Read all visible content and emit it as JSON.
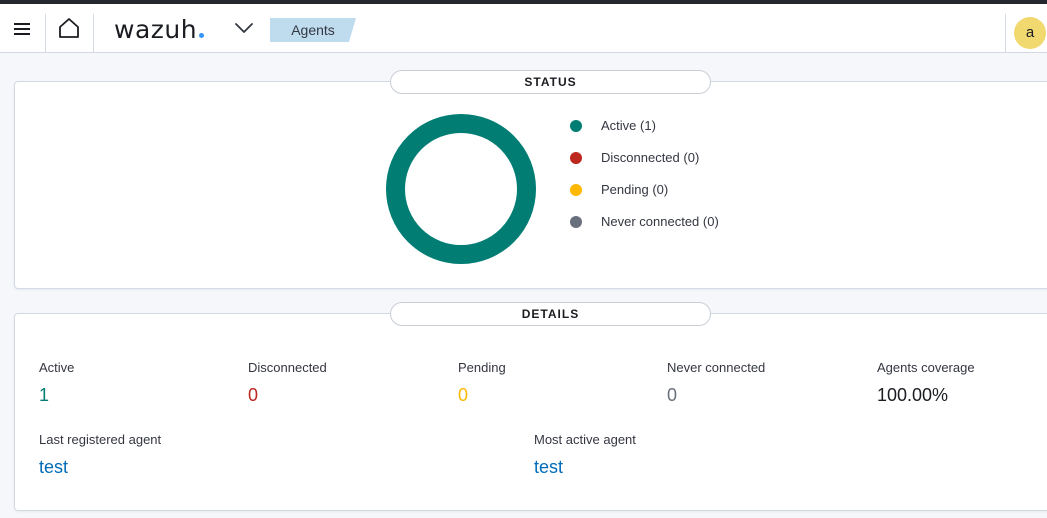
{
  "header": {
    "logo_text": "wazuh",
    "breadcrumb": "Agents",
    "avatar_letter": "a",
    "icons": [
      "menu-icon",
      "home-icon",
      "chevron-down-icon"
    ]
  },
  "status": {
    "title": "STATUS",
    "donut_color": "#017d73",
    "legend": [
      {
        "label": "Active (1)",
        "color": "#017d73"
      },
      {
        "label": "Disconnected (0)",
        "color": "#bd271e"
      },
      {
        "label": "Pending (0)",
        "color": "#feb800"
      },
      {
        "label": "Never connected (0)",
        "color": "#69707d"
      }
    ]
  },
  "details": {
    "title": "DETAILS",
    "stats": [
      {
        "label": "Active",
        "value": "1",
        "color": "#017d73"
      },
      {
        "label": "Disconnected",
        "value": "0",
        "color": "#bd271e"
      },
      {
        "label": "Pending",
        "value": "0",
        "color": "#feb800"
      },
      {
        "label": "Never connected",
        "value": "0",
        "color": "#69707d"
      },
      {
        "label": "Agents coverage",
        "value": "100.00%",
        "color": "#1a1c21"
      }
    ],
    "last_registered_label": "Last registered agent",
    "last_registered_value": "test",
    "most_active_label": "Most active agent",
    "most_active_value": "test"
  }
}
